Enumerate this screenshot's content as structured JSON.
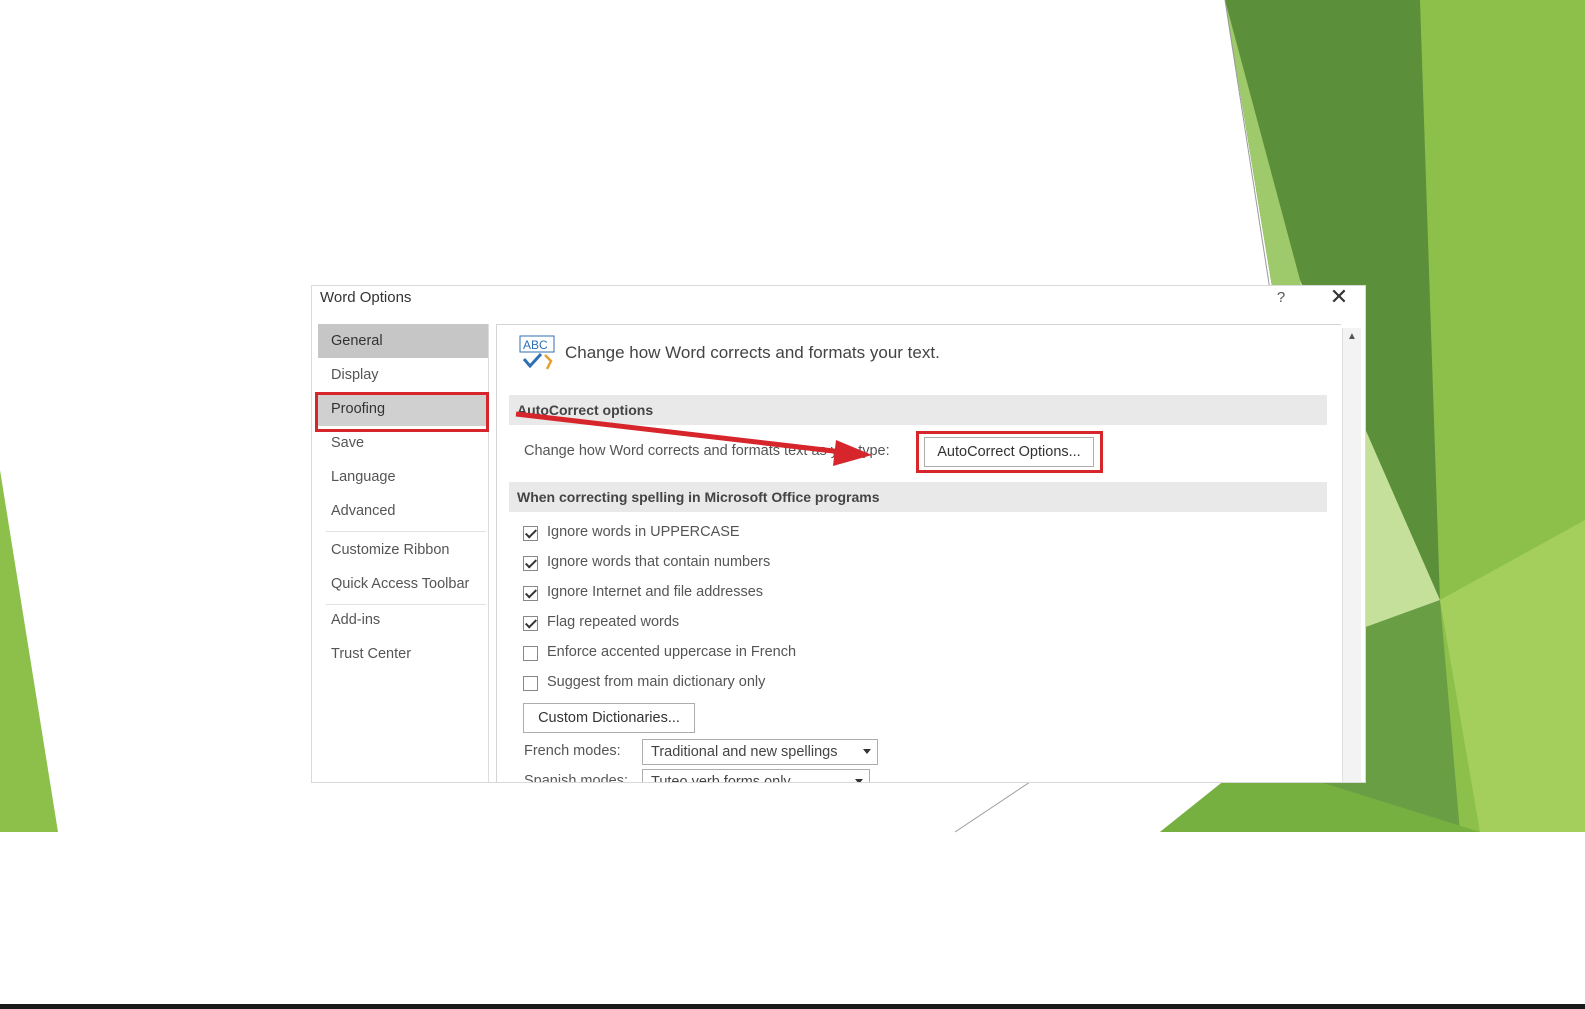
{
  "colors": {
    "highlight": "#d6262b",
    "green_dark": "#5c8f3a",
    "green_mid": "#76b041",
    "green_light": "#a9d063"
  },
  "dialog": {
    "title": "Word Options",
    "help_label": "?",
    "close_label": "✕",
    "nav": [
      {
        "label": "General"
      },
      {
        "label": "Display"
      },
      {
        "label": "Proofing"
      },
      {
        "label": "Save"
      },
      {
        "label": "Language"
      },
      {
        "label": "Advanced"
      },
      {
        "label": "Customize Ribbon"
      },
      {
        "label": "Quick Access Toolbar"
      },
      {
        "label": "Add-ins"
      },
      {
        "label": "Trust Center"
      }
    ],
    "icon_text": "ABC",
    "header": "Change how Word corrects and formats your text.",
    "autocorrect": {
      "section_title": "AutoCorrect options",
      "description": "Change how Word corrects and formats text as you type:",
      "button_label": "AutoCorrect Options..."
    },
    "spelling": {
      "section_title": "When correcting spelling in Microsoft Office programs",
      "options": [
        {
          "label": "Ignore words in UPPERCASE",
          "checked": true
        },
        {
          "label": "Ignore words that contain numbers",
          "checked": true
        },
        {
          "label": "Ignore Internet and file addresses",
          "checked": true
        },
        {
          "label": "Flag repeated words",
          "checked": true
        },
        {
          "label": "Enforce accented uppercase in French",
          "checked": false
        },
        {
          "label": "Suggest from main dictionary only",
          "checked": false
        }
      ],
      "custom_dictionaries_label": "Custom Dictionaries...",
      "french_modes_label": "French modes:",
      "french_modes_value": "Traditional and new spellings",
      "spanish_modes_label": "Spanish modes:",
      "spanish_modes_value": "Tuteo verb forms only"
    },
    "scroll_up_label": "▲"
  }
}
